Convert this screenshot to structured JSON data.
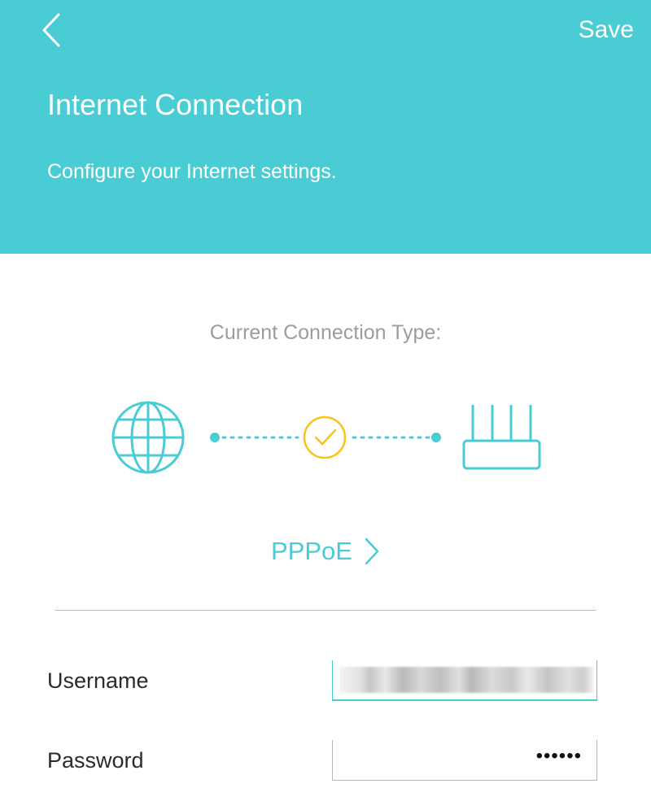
{
  "header": {
    "back_icon": "chevron-left-icon",
    "save_label": "Save",
    "title": "Internet Connection",
    "subtitle": "Configure your Internet settings."
  },
  "connection": {
    "section_label": "Current Connection Type:",
    "type": "PPPoE",
    "icons": [
      "globe-icon",
      "check-circle-icon",
      "router-icon",
      "chevron-right-icon"
    ]
  },
  "form": {
    "username_label": "Username",
    "password_label": "Password",
    "password_value": "••••••"
  },
  "colors": {
    "accent": "#4accd4",
    "status_ok": "#f5c518",
    "label_gray": "#9c9c9c"
  }
}
